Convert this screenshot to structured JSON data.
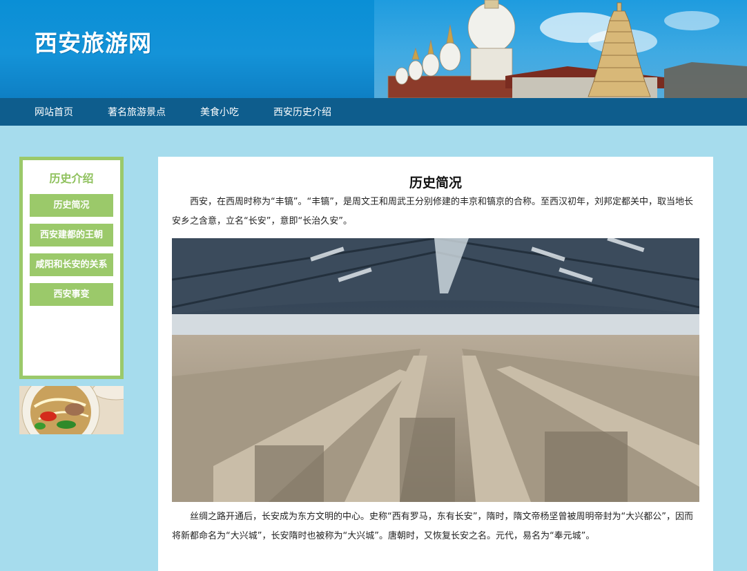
{
  "header": {
    "logo": "西安旅游网"
  },
  "nav": {
    "items": [
      "网站首页",
      "著名旅游景点",
      "美食小吃",
      "西安历史介绍"
    ]
  },
  "sidebar": {
    "title": "历史介绍",
    "items": [
      "历史简况",
      "西安建都的王朝",
      "咸阳和长安的关系",
      "西安事变"
    ]
  },
  "main": {
    "title": "历史简况",
    "paragraphs": [
      "西安，在西周时称为“丰镐”。“丰镐”，是周文王和周武王分别修建的丰京和镐京的合称。至西汉初年，刘邦定都关中，取当地长安乡之含意，立名“长安”，意即“长治久安”。",
      "丝绸之路开通后，长安成为东方文明的中心。史称“西有罗马，东有长安”，隋时，隋文帝杨坚曾被周明帝封为“大兴都公”，因而将新都命名为“大兴城”，长安隋时也被称为“大兴城”。唐朝时，又恢复长安之名。元代，易名为“奉元城”。"
    ]
  },
  "colors": {
    "header": "#0a8fd6",
    "nav": "#0e5d8d",
    "accent": "#9bc96a",
    "page_bg": "#a6dced"
  }
}
